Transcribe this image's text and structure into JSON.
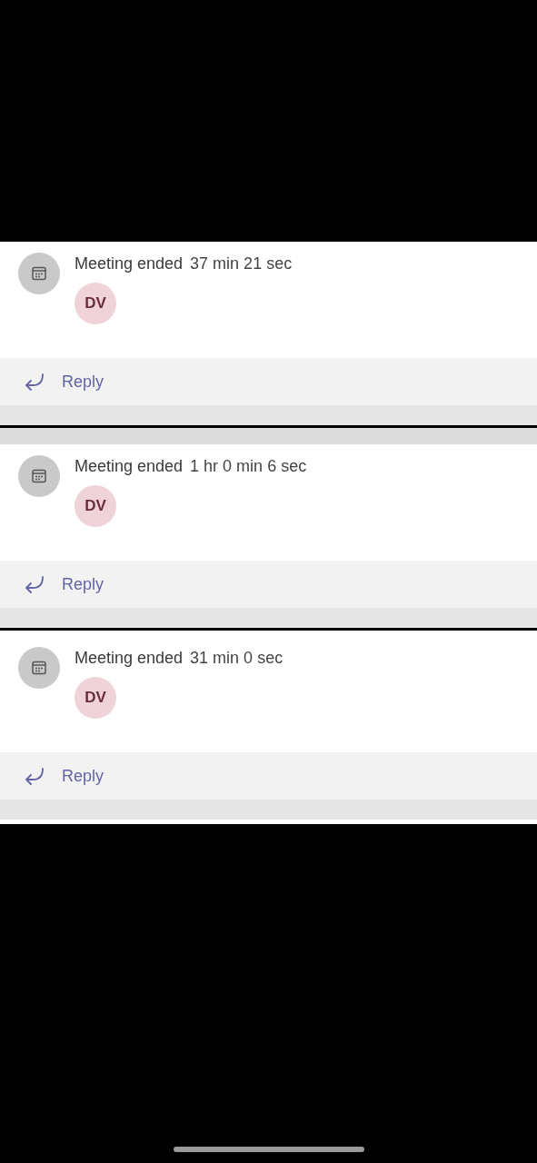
{
  "cards": [
    {
      "title": "Meeting ended",
      "duration": "37 min 21 sec",
      "avatar": "DV",
      "reply": "Reply"
    },
    {
      "title": "Meeting ended",
      "duration": "1 hr 0 min 6 sec",
      "avatar": "DV",
      "reply": "Reply"
    },
    {
      "title": "Meeting ended",
      "duration": "31 min 0 sec",
      "avatar": "DV",
      "reply": "Reply"
    }
  ]
}
